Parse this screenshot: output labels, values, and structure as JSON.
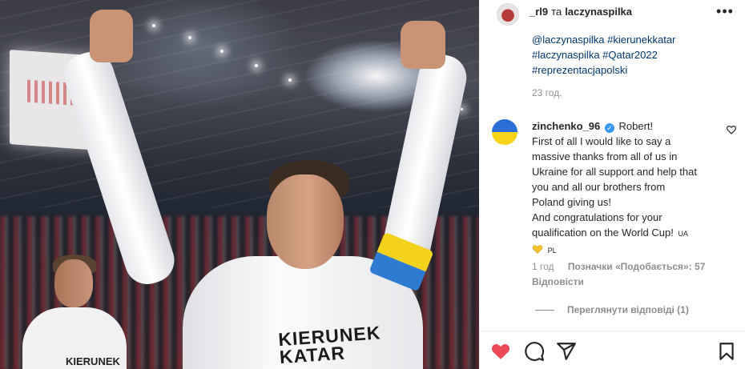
{
  "post": {
    "photo_shirt_text": [
      "KIERUNEK",
      "KATAR"
    ],
    "background_player_shirt_text": "KIERUNEK"
  },
  "header": {
    "username": "_rl9",
    "joiner": "та",
    "collaborator": "laczynaspilka",
    "more_icon": "more-horizontal-icon"
  },
  "caption": {
    "lines": [
      "@laczynaspilka #kierunekkatar",
      "#laczynaspilka #Qatar2022",
      "#reprezentacjapolski"
    ],
    "time": "23 год."
  },
  "comment": {
    "username": "zinchenko_96",
    "verified": true,
    "lines": [
      "Robert!",
      "First of all I would like to say a",
      "massive thanks from all of us in",
      "Ukraine for all support and help that",
      "you and all our brothers from",
      "Poland giving us!",
      "And congratulations for your",
      "qualification on the World Cup!"
    ],
    "flag_ua": "UA",
    "flag_pl": "PL",
    "time": "1 год",
    "likes": "Позначки «Подобається»: 57",
    "reply": "Відповісти",
    "view_replies": "Переглянути відповіді (1)"
  },
  "colors": {
    "like_red": "#ed4956",
    "link_blue": "#00376b",
    "muted": "#8e8e8e"
  },
  "actions": {
    "like": "heart-filled-icon",
    "comment": "comment-bubble-icon",
    "share": "paper-plane-icon",
    "save": "bookmark-icon"
  }
}
